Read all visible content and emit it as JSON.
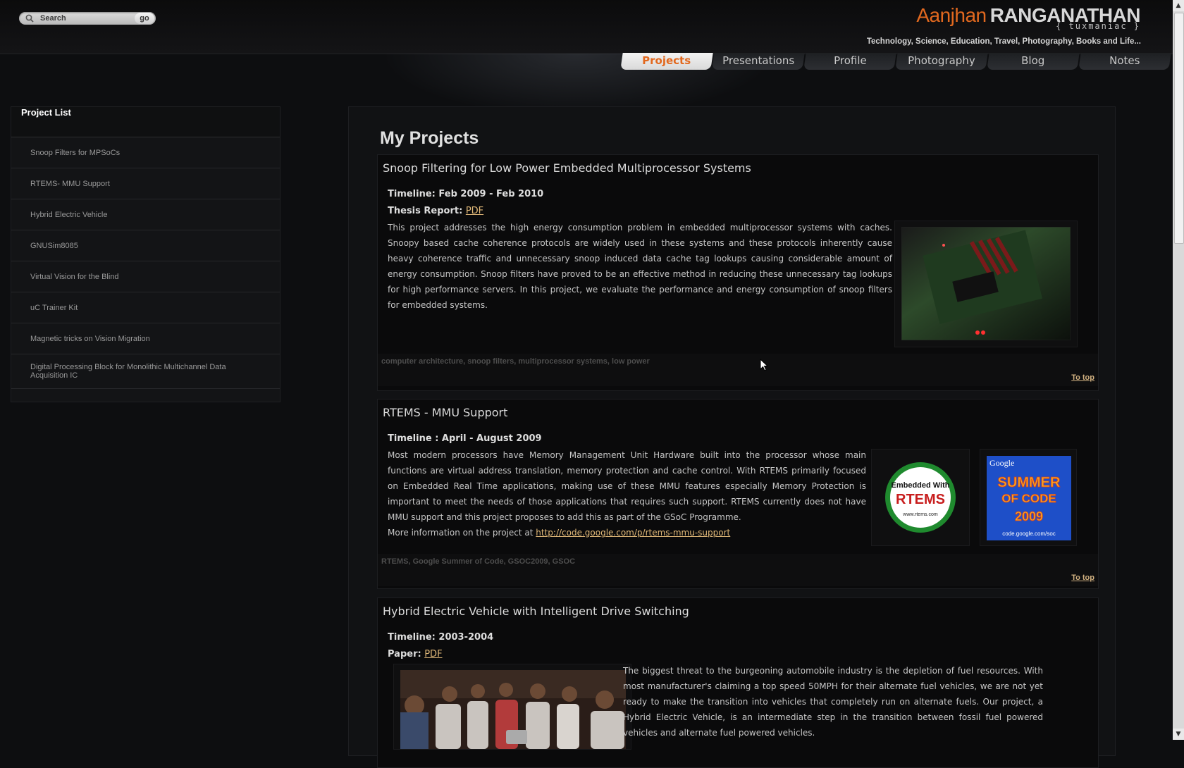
{
  "header": {
    "search_placeholder": "Search",
    "go_label": "go",
    "brand_first": "Aanjhan",
    "brand_last": "RANGANATHAN",
    "nickname": "{ tuxmaniac }",
    "tagline": "Technology, Science, Education, Travel, Photography, Books and Life..."
  },
  "tabs": [
    "Projects",
    "Presentations",
    "Profile",
    "Photography",
    "Blog",
    "Notes"
  ],
  "active_tab": "Projects",
  "sidebar": {
    "title": "Project List",
    "items": [
      "Snoop Filters for MPSoCs",
      "RTEMS- MMU Support",
      "Hybrid Electric Vehicle",
      "GNUSim8085",
      "Virtual Vision for the Blind",
      "uC Trainer Kit",
      "Magnetic tricks on Vision Migration",
      "Digital Processing Block for Monolithic Multichannel Data Acquisition IC"
    ]
  },
  "main": {
    "title": "My Projects",
    "projects": [
      {
        "title": "Snoop Filtering for Low Power Embedded Multiprocessor Systems",
        "timeline": "Timeline: Feb 2009 - Feb 2010",
        "report_label": "Thesis Report:",
        "report_link": "PDF",
        "description": "This project addresses the high energy consumption problem in embedded multiprocessor systems with caches. Snoopy based cache coherence protocols are widely used in these systems and these protocols inherently cause heavy coherence traffic and unnecessary snoop induced data cache tag lookups causing considerable amount of energy consumption. Snoop filters have proved to be an effective method in reducing these unnecessary tag lookups for high performance servers. In this project, we evaluate the performance and energy consumption of snoop filters for embedded systems.",
        "tags": "computer architecture, snoop filters, multiprocessor systems, low power",
        "to_top": "To top"
      },
      {
        "title": "RTEMS - MMU Support",
        "timeline": "Timeline : April - August 2009",
        "description": "Most modern processors have Memory Management Unit Hardware built into the processor whose main functions are virtual address translation, memory protection and cache control. With RTEMS primarily focused on Embedded Real Time applications, making use of these MMU features especially Memory Protection is important to meet the needs of those applications that requires such support. RTEMS currently does not have MMU support and this project proposes to add this as part of the GSoC Programme.",
        "more_info_label": "More information on the project at",
        "more_info_link": "http://code.google.com/p/rtems-mmu-support",
        "logo1_line1": "Embedded With",
        "logo1_line2": "RTEMS",
        "logo1_url": "www.rtems.com",
        "logo2_brand": "Google",
        "logo2_line1": "SUMMER",
        "logo2_line2": "OF CODE",
        "logo2_year": "2009",
        "logo2_url": "code.google.com/soc",
        "tags": "RTEMS, Google Summer of Code, GSOC2009, GSOC",
        "to_top": "To top"
      },
      {
        "title": "Hybrid Electric Vehicle with Intelligent Drive Switching",
        "timeline": "Timeline: 2003-2004",
        "report_label": "Paper:",
        "report_link": "PDF",
        "description": "The biggest threat to the burgeoning automobile industry is the depletion of fuel resources. With most manufacturer's claiming a top speed 50MPH for their alternate fuel vehicles, we are not yet ready to make the transition into vehicles that completely run on alternate fuels. Our project, a Hybrid Electric Vehicle, is an intermediate step in the transition between fossil fuel powered vehicles and alternate fuel powered vehicles."
      }
    ]
  },
  "scrollbar": {
    "up": "▲",
    "down": "▼",
    "position": 0.0
  }
}
